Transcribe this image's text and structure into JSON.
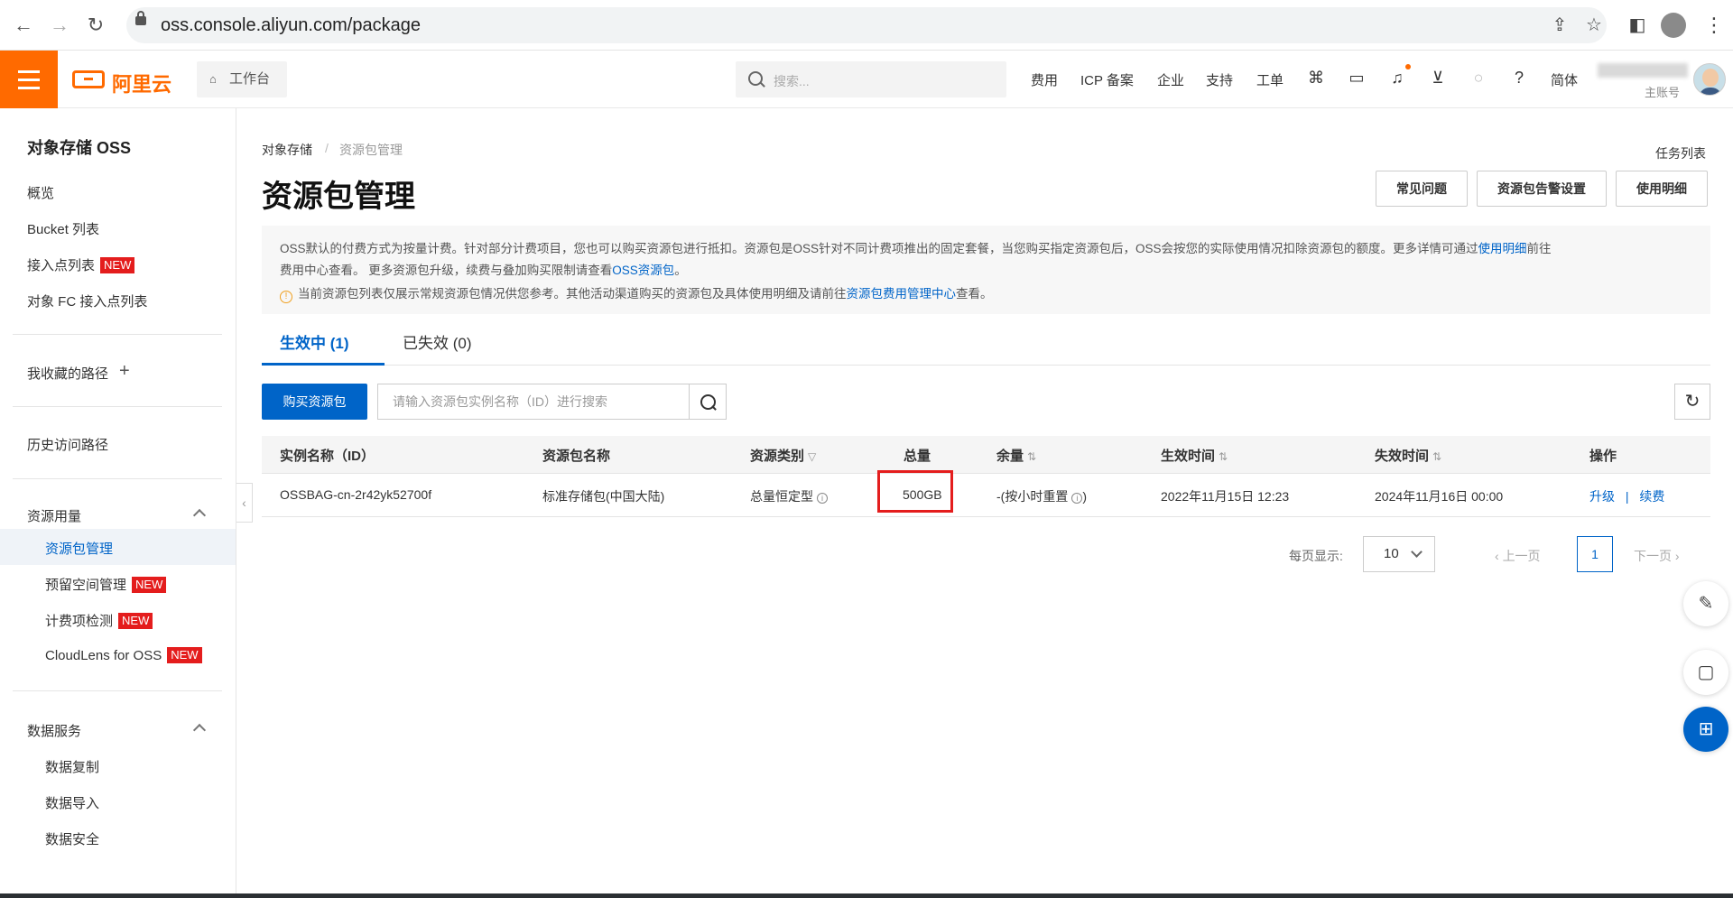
{
  "browser": {
    "url": "oss.console.aliyun.com/package",
    "icons": [
      "back-icon",
      "forward-icon",
      "reload-icon",
      "share-icon",
      "star-icon",
      "sidepanel-icon",
      "profile-icon",
      "menu-icon"
    ]
  },
  "topbar": {
    "logo": "阿里云",
    "workbench": "工作台",
    "search_placeholder": "搜索...",
    "links": [
      "费用",
      "ICP 备案",
      "企业",
      "支持",
      "工单"
    ],
    "lang": "简体",
    "account_sub": "主账号",
    "accent": "#ff6a00"
  },
  "sidebar": {
    "title": "对象存储 OSS",
    "items": [
      "概览",
      "Bucket 列表",
      "接入点列表",
      "对象 FC 接入点列表"
    ],
    "new_badge": "NEW",
    "favorites": "我收藏的路径",
    "history": "历史访问路径",
    "group1": {
      "title": "资源用量",
      "items": [
        "资源包管理",
        "预留空间管理",
        "计费项检测",
        "CloudLens for OSS"
      ]
    },
    "group2": {
      "title": "数据服务",
      "items": [
        "数据复制",
        "数据导入",
        "数据安全"
      ]
    }
  },
  "main": {
    "breadcrumb": [
      "对象存储",
      "/",
      "资源包管理"
    ],
    "task_list": "任务列表",
    "title": "资源包管理",
    "header_buttons": [
      "常见问题",
      "资源包告警设置",
      "使用明细"
    ],
    "notice": {
      "line1_a": "OSS默认的付费方式为按量计费。针对部分计费项目，您也可以购买资源包进行抵扣。资源包是OSS针对不同计费项推出的固定套餐，当您购买指定资源包后，OSS会按您的实际使用情况扣除资源包的额度。更多详情可通过",
      "line1_link": "使用明细",
      "line1_b": "前往",
      "line2_a": "费用中心查看。 更多资源包升级，续费与叠加购买限制请查看",
      "line2_link": "OSS资源包",
      "line2_b": "。",
      "line3_a": "当前资源包列表仅展示常规资源包情况供您参考。其他活动渠道购买的资源包及具体使用明细及请前往",
      "line3_link": "资源包费用管理中心",
      "line3_b": "查看。"
    },
    "tabs": [
      {
        "label": "生效中",
        "count": "(1)"
      },
      {
        "label": "已失效",
        "count": "(0)"
      }
    ],
    "buy_button": "购买资源包",
    "search_placeholder": "请输入资源包实例名称（ID）进行搜索",
    "table": {
      "columns": [
        "实例名称（ID）",
        "资源包名称",
        "资源类别",
        "总量",
        "余量",
        "生效时间",
        "失效时间",
        "操作"
      ],
      "rows": [
        {
          "id": "OSSBAG-cn-2r42yk52700f",
          "name": "标准存储包(中国大陆)",
          "category": "总量恒定型",
          "total": "500GB",
          "remaining": "-(按小时重置",
          "start": "2022年11月15日 12:23",
          "end": "2024年11月16日 00:00",
          "actions": [
            "升级",
            "|",
            "续费"
          ]
        }
      ]
    },
    "pager": {
      "label": "每页显示:",
      "page_size": "10",
      "prev": "上一页",
      "page": "1",
      "next": "下一页"
    },
    "primary_color": "#0064c8",
    "highlight_color": "#e41d1d"
  }
}
